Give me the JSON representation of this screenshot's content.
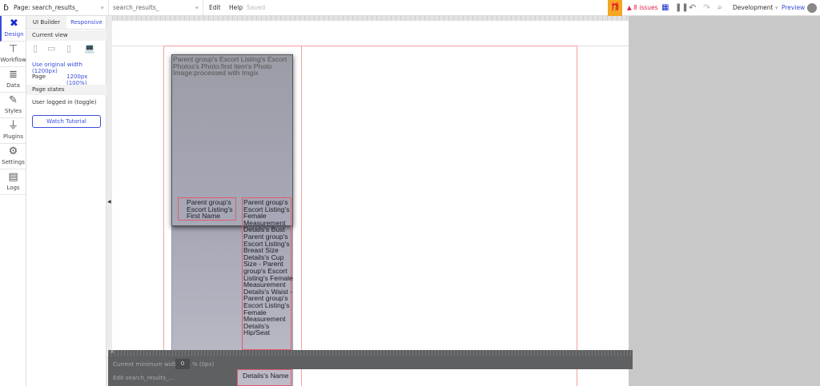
{
  "topbar": {
    "page_label": "Page: search_results_",
    "element_select": "search_results_",
    "edit": "Edit",
    "help": "Help",
    "saved": "Saved",
    "issues": "8 issues",
    "environment": "Development",
    "preview": "Preview"
  },
  "iconbar": {
    "items": [
      {
        "label": "Design"
      },
      {
        "label": "Workflow"
      },
      {
        "label": "Data"
      },
      {
        "label": "Styles"
      },
      {
        "label": "Plugins"
      },
      {
        "label": "Settings"
      },
      {
        "label": "Logs"
      }
    ]
  },
  "panel": {
    "tab_ui_builder": "UI Builder",
    "tab_responsive": "Responsive",
    "current_view": "Current view",
    "use_original": "Use original width (1200px)",
    "page_label": "Page",
    "page_value": "1200px (100%)",
    "page_states": "Page states",
    "state_item": "User logged in (toggle)",
    "watch_tutorial": "Watch Tutorial"
  },
  "canvas": {
    "image_text": "Parent group's Escort Listing's Escort Photos's Photo:first item's Photo Image:processed with Imgix",
    "first_name_text": "Parent group's Escort Listing's First Name",
    "measure_text": "Parent group's Escort Listing's Female Measurement Details's Bust Parent group's Escort Listing's Breast Size Details's Cup Size - Parent group's Escort Listing's Female Measurement Details's Waist - Parent group's Escort Listing's Female Measurement Details's Hip/Seat",
    "name_text": "Details's Name"
  },
  "bottom": {
    "close": "×",
    "min_width_label": "Current minimum width",
    "min_width_value": "0",
    "min_width_unit": "% (0px)",
    "edit_label": "Edit search_results_..."
  },
  "colors": {
    "accent": "#3a4ddb",
    "issues": "#e0204a",
    "gift": "#f5a623"
  }
}
